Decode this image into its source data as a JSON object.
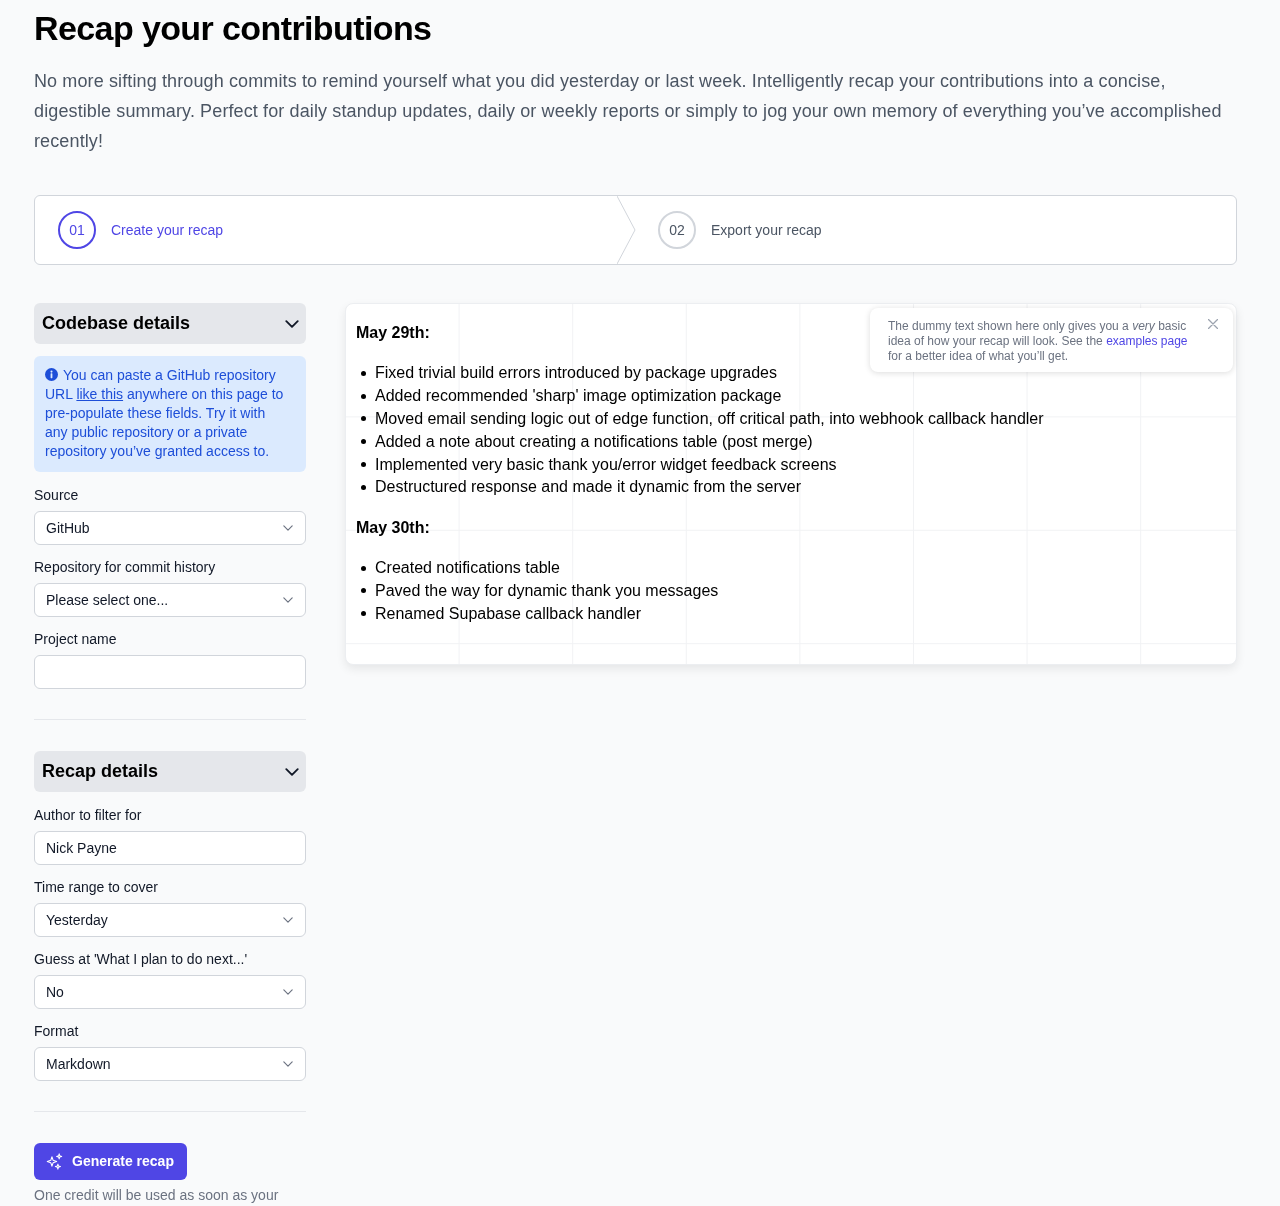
{
  "page": {
    "title": "Recap your contributions",
    "intro": "No more sifting through commits to remind yourself what you did yesterday or last week. Intelligently recap your contributions into a concise, digestible summary. Perfect for daily standup updates, daily or weekly reports or simply to jog your own memory of everything you’ve accomplished recently!"
  },
  "steps": [
    {
      "number": "01",
      "label": "Create your recap",
      "selected": true
    },
    {
      "number": "02",
      "label": "Export your recap",
      "selected": false
    }
  ],
  "sections": [
    {
      "title": "Codebase details",
      "expanded": true,
      "info": {
        "before": "You can paste a GitHub repository URL ",
        "link": "like this",
        "after": " anywhere on this page to pre-populate these fields. Try it with any public repository or a private repository you’ve granted access to."
      },
      "fields": [
        {
          "label": "Source",
          "kind": "select",
          "value": "GitHub"
        },
        {
          "label": "Repository for commit history",
          "kind": "select",
          "value": "Please select one..."
        },
        {
          "label": "Project name",
          "kind": "text"
        }
      ]
    },
    {
      "title": "Recap details",
      "expanded": true,
      "fields": [
        {
          "label": "Author to filter for",
          "kind": "text",
          "value": "Nick Payne"
        },
        {
          "label": "Time range to cover",
          "kind": "select",
          "value": "Yesterday"
        },
        {
          "label": "Guess at 'What I plan to do next...'",
          "kind": "select",
          "value": "No"
        },
        {
          "label": "Format",
          "kind": "select",
          "value": "Markdown"
        }
      ]
    }
  ],
  "generate_button": {
    "label": "Generate recap"
  },
  "credit_note": "One credit will be used as soon as your",
  "preview": {
    "days": [
      {
        "heading": "May 29th:",
        "items": [
          "Fixed trivial build errors introduced by package upgrades",
          "Added recommended 'sharp' image optimization package",
          "Moved email sending logic out of edge function, off critical path, into webhook callback handler",
          "Added a note about creating a notifications table (post merge)",
          "Implemented very basic thank you/error widget feedback screens",
          "Destructured response and made it dynamic from the server"
        ]
      },
      {
        "heading": "May 30th:",
        "items": [
          "Created notifications table",
          "Paved the way for dynamic thank you messages",
          "Renamed Supabase callback handler"
        ]
      }
    ],
    "notice": {
      "text": "The dummy text shown here only gives you a *very* basic idea of how your recap will look. See the ",
      "link": "examples page",
      "after": " for a better idea of what you’ll get."
    }
  }
}
